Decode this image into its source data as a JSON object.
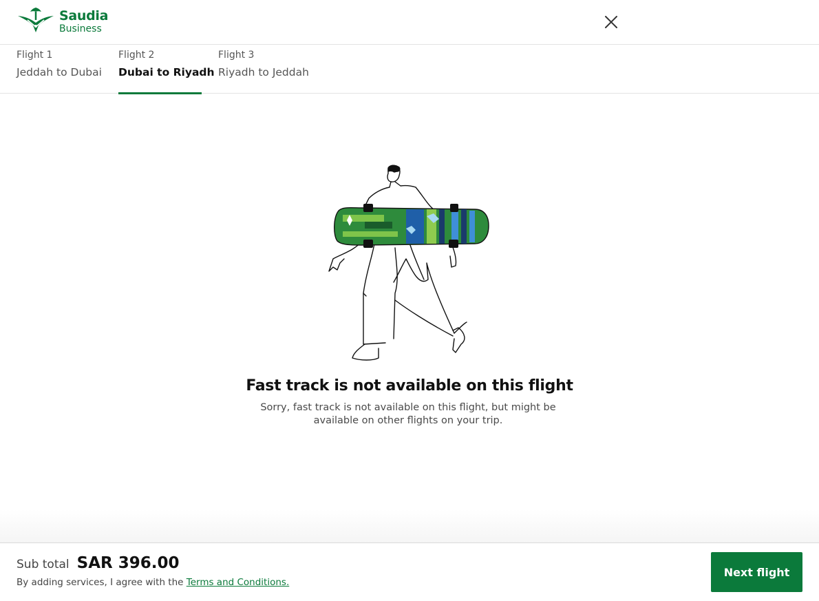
{
  "header": {
    "logo_brand": "Saudia",
    "logo_sub": "Business",
    "close_icon": "close-icon"
  },
  "tabs": [
    {
      "number": "Flight 1",
      "route": "Jeddah to Dubai",
      "active": false
    },
    {
      "number": "Flight 2",
      "route": "Dubai to Riyadh",
      "active": true
    },
    {
      "number": "Flight 3",
      "route": "Riyadh to Jeddah",
      "active": false
    }
  ],
  "message": {
    "title": "Fast track is not available on this flight",
    "text": "Sorry, fast track is not available on this flight, but might be available on other flights on your trip."
  },
  "footer": {
    "subtotal_label": "Sub total",
    "subtotal_value": "SAR 396.00",
    "terms_prefix": "By adding services, I agree with the",
    "terms_link": "Terms and Conditions.",
    "next_button": "Next flight"
  },
  "colors": {
    "brand_green": "#0b7a3b",
    "active_tab_underline": "#0b7a3b"
  }
}
